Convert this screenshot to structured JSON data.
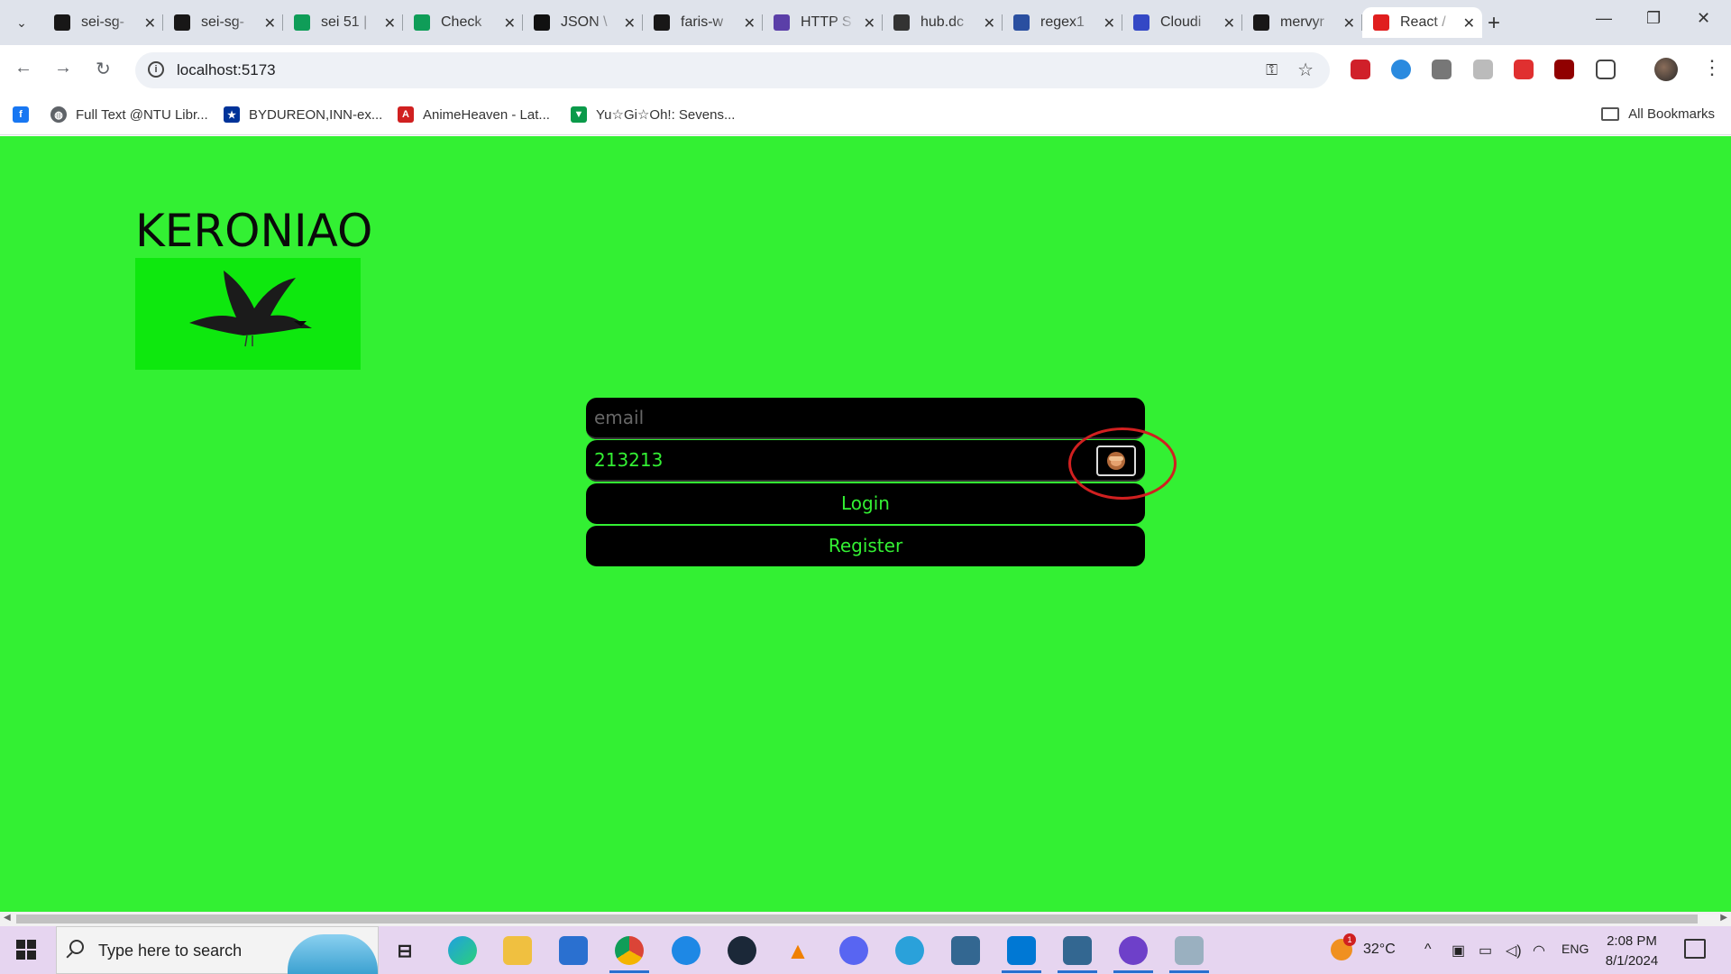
{
  "browser": {
    "tabs": [
      {
        "title": "sei-sg-",
        "favicon": "github-icon",
        "color": "#181717",
        "active": false
      },
      {
        "title": "sei-sg-",
        "favicon": "github-icon",
        "color": "#181717",
        "active": false
      },
      {
        "title": "sei 51 |",
        "favicon": "sheets-icon",
        "color": "#0f9d58",
        "active": false
      },
      {
        "title": "Check",
        "favicon": "sheets-icon",
        "color": "#0f9d58",
        "active": false
      },
      {
        "title": "JSON \\",
        "favicon": "json-icon",
        "color": "#111111",
        "active": false
      },
      {
        "title": "faris-w",
        "favicon": "github-icon",
        "color": "#181717",
        "active": false
      },
      {
        "title": "HTTP S",
        "favicon": "http-icon",
        "color": "#5b3fa8",
        "active": false
      },
      {
        "title": "hub.dc",
        "favicon": "docker-hub-icon",
        "color": "#333333",
        "active": false
      },
      {
        "title": "regex1",
        "favicon": "regex-icon",
        "color": "#2a4fa0",
        "active": false
      },
      {
        "title": "Cloudi",
        "favicon": "cloudinary-icon",
        "color": "#3448c5",
        "active": false
      },
      {
        "title": "mervyr",
        "favicon": "github-icon",
        "color": "#181717",
        "active": false
      },
      {
        "title": "React /",
        "favicon": "ga-icon",
        "color": "#e01e1e",
        "active": true
      }
    ],
    "url": "localhost:5173",
    "bookmarks": [
      {
        "label": "Full Text @NTU Libr...",
        "icon": "facebook-icon",
        "color": "#1877f2"
      },
      {
        "label": "",
        "icon": "globe-icon",
        "color": "#5f6368"
      },
      {
        "label": "BYDUREON,INN-ex...",
        "icon": "eu-flag-icon",
        "color": "#003399"
      },
      {
        "label": "AnimeHeaven - Lat...",
        "icon": "animeheaven-icon",
        "color": "#d02020"
      },
      {
        "label": "Yu☆Gi☆Oh!: Sevens...",
        "icon": "tv-icon",
        "color": "#0a9a4a"
      }
    ],
    "all_bookmarks_label": "All Bookmarks"
  },
  "page": {
    "brand": "KERONIAO",
    "logo_icon": "crow-icon",
    "email_placeholder": "email",
    "password_value": "213213",
    "toggle_icon": "see-no-evil-monkey-icon",
    "login_label": "Login",
    "register_label": "Register",
    "accent": "#33f033"
  },
  "taskbar": {
    "search_placeholder": "Type here to search",
    "temperature": "32°C",
    "language": "ENG",
    "time": "2:08 PM",
    "date": "8/1/2024",
    "weather_badge": "1"
  }
}
